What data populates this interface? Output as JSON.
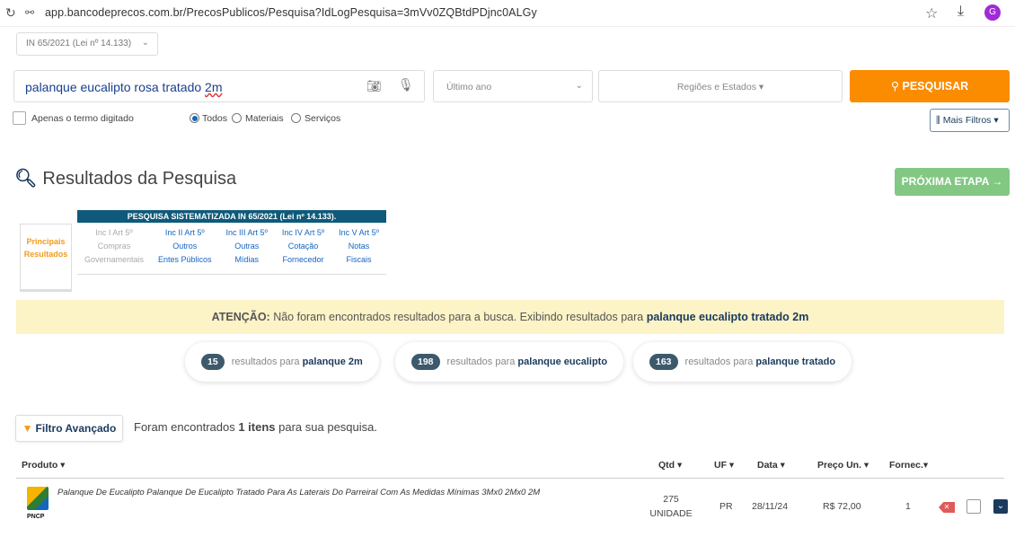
{
  "browser": {
    "reload_icon": "reload-icon",
    "site_info_icon": "site-info-icon",
    "url": "app.bancodeprecos.com.br/PrecosPublicos/Pesquisa?IdLogPesquisa=3mVv0ZQBtdPDjnc0ALGy",
    "profile_initial": "G"
  },
  "norm_select": {
    "value": "IN 65/2021 (Lei nº 14.133)"
  },
  "search": {
    "query_before": "palanque eucalipto rosa tratado ",
    "query_flagged": "2m",
    "period": "Último ano",
    "regions": "Regiões e Estados ▾",
    "button_label": "PESQUISAR"
  },
  "options": {
    "exact_term_label": "Apenas o termo digitado",
    "radios": [
      {
        "label": "Todos",
        "selected": true
      },
      {
        "label": "Materiais",
        "selected": false
      },
      {
        "label": "Serviços",
        "selected": false
      }
    ],
    "more_filters_label": "Mais Filtros"
  },
  "results": {
    "title": "Resultados da Pesquisa",
    "next_step_label": "PRÓXIMA ETAPA →"
  },
  "systematized": {
    "header": "PESQUISA SISTEMATIZADA IN 65/2021 (Lei nº 14.133).",
    "principal": [
      "Principais",
      "Resultados"
    ],
    "columns": [
      {
        "lines": [
          "Inc I Art 5º",
          "Compras",
          "Governamentais"
        ],
        "enabled": false
      },
      {
        "lines": [
          "Inc II Art 5º",
          "Outros",
          "Entes Públicos"
        ],
        "enabled": true
      },
      {
        "lines": [
          "Inc III Art 5º",
          "Outras",
          "Mídias"
        ],
        "enabled": true
      },
      {
        "lines": [
          "Inc IV Art 5º",
          "Cotação",
          "Fornecedor"
        ],
        "enabled": true
      },
      {
        "lines": [
          "Inc V Art 5º",
          "Notas",
          "Fiscais"
        ],
        "enabled": true
      }
    ]
  },
  "attention": {
    "label": "ATENÇÃO:",
    "message": " Não foram encontrados resultados para a busca. Exibindo resultados para ",
    "term": "palanque eucalipto tratado 2m"
  },
  "pills": [
    {
      "count": "15",
      "text": "resultados para ",
      "term": "palanque 2m"
    },
    {
      "count": "198",
      "text": "resultados para ",
      "term": "palanque eucalipto"
    },
    {
      "count": "163",
      "text": "resultados para ",
      "term": "palanque tratado"
    }
  ],
  "filter": {
    "button_label": "Filtro Avançado",
    "found_prefix": "Foram encontrados ",
    "found_count": "1 itens",
    "found_suffix": " para sua pesquisa."
  },
  "table": {
    "headers": {
      "product": "Produto ▾",
      "qty": "Qtd ▾",
      "uf": "UF ▾",
      "date": "Data ▾",
      "price": "Preço Un. ▾",
      "supplier": "Fornec.▾"
    },
    "rows": [
      {
        "source_logo": "PNCP",
        "description": "Palanque De Eucalipto Palanque De Eucalipto Tratado Para As Laterais Do Parreiral Com As Medidas Mínimas 3Mx0 2Mx0 2M",
        "qty": "275",
        "unit": "UNIDADE",
        "uf": "PR",
        "date": "28/11/24",
        "price": "R$ 72,00",
        "supplier": "1"
      }
    ]
  },
  "colors": {
    "accent_orange": "#fb8c00",
    "next_step_green": "#82c883",
    "banner_yellow": "#fcf3c6",
    "navy": "#1a3a5e",
    "sys_header_teal": "#0f5a7a"
  }
}
